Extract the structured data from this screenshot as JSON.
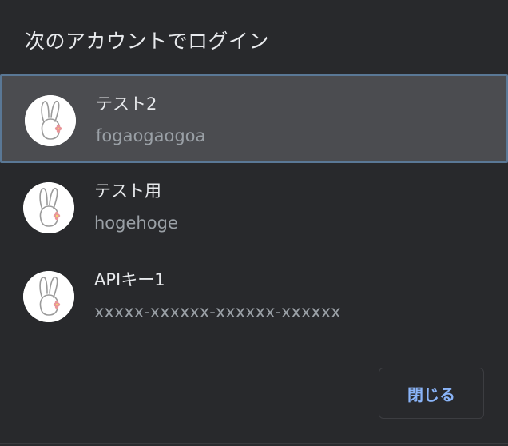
{
  "dialog": {
    "title": "次のアカウントでログイン",
    "accounts": [
      {
        "name": "テスト2",
        "sub": "fogaogaogoa",
        "selected": true,
        "avatar_icon": "rabbit-avatar-icon"
      },
      {
        "name": "テスト用",
        "sub": "hogehoge",
        "selected": false,
        "avatar_icon": "rabbit-avatar-icon"
      },
      {
        "name": "APIキー1",
        "sub": "xxxxx-xxxxxx-xxxxxx-xxxxxx",
        "selected": false,
        "avatar_icon": "rabbit-avatar-icon"
      }
    ],
    "close_label": "閉じる"
  },
  "colors": {
    "background": "#28292c",
    "selected_background": "#4b4c50",
    "selected_border": "#5a7896",
    "primary_text": "#e8eaed",
    "secondary_text": "#9aa0a6",
    "button_text": "#8ab4f8",
    "flower_accent": "#e8969a"
  }
}
